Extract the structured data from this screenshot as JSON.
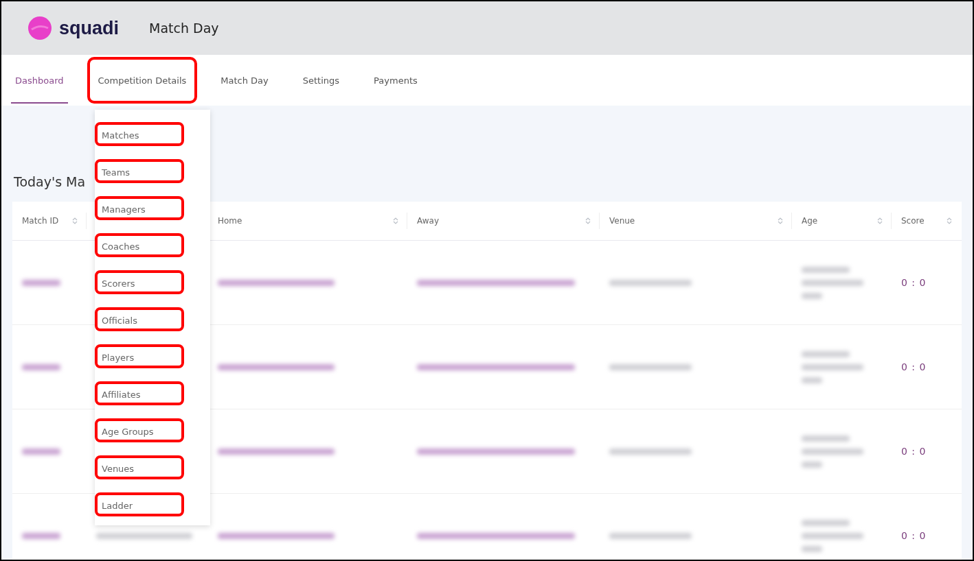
{
  "header": {
    "logo_text": "squadi",
    "title": "Match Day"
  },
  "tabs": [
    {
      "label": "Dashboard",
      "selected": true,
      "highlighted": false
    },
    {
      "label": "Competition Details",
      "selected": false,
      "highlighted": true
    },
    {
      "label": "Match Day",
      "selected": false,
      "highlighted": false
    },
    {
      "label": "Settings",
      "selected": false,
      "highlighted": false
    },
    {
      "label": "Payments",
      "selected": false,
      "highlighted": false
    }
  ],
  "dropdown": {
    "items": [
      {
        "label": "Matches",
        "highlighted": true
      },
      {
        "label": "Teams",
        "highlighted": true
      },
      {
        "label": "Managers",
        "highlighted": true
      },
      {
        "label": "Coaches",
        "highlighted": true
      },
      {
        "label": "Scorers",
        "highlighted": true
      },
      {
        "label": "Officials",
        "highlighted": true
      },
      {
        "label": "Players",
        "highlighted": true
      },
      {
        "label": "Affiliates",
        "highlighted": true
      },
      {
        "label": "Age Groups",
        "highlighted": true
      },
      {
        "label": "Venues",
        "highlighted": true
      },
      {
        "label": "Ladder",
        "highlighted": true
      }
    ]
  },
  "section_title": "Today's Ma",
  "table": {
    "columns": [
      {
        "label": "Match ID"
      },
      {
        "label": "Home"
      },
      {
        "label": "Away"
      },
      {
        "label": "Venue"
      },
      {
        "label": "Age"
      },
      {
        "label": "Score"
      }
    ],
    "rows": [
      {
        "score": "0 : 0"
      },
      {
        "score": "0 : 0"
      },
      {
        "score": "0 : 0"
      },
      {
        "score": "0 : 0"
      }
    ]
  }
}
